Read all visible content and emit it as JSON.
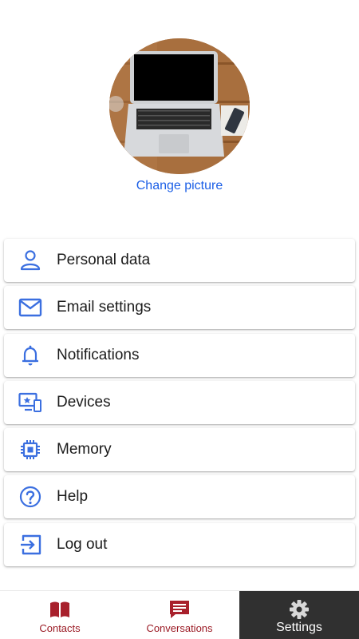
{
  "profile": {
    "change_picture_label": "Change picture"
  },
  "menu": {
    "items": [
      {
        "label": "Personal data",
        "icon": "person-icon"
      },
      {
        "label": "Email settings",
        "icon": "mail-icon"
      },
      {
        "label": "Notifications",
        "icon": "bell-icon"
      },
      {
        "label": "Devices",
        "icon": "devices-icon"
      },
      {
        "label": "Memory",
        "icon": "chip-icon"
      },
      {
        "label": "Help",
        "icon": "help-icon"
      },
      {
        "label": "Log out",
        "icon": "logout-icon"
      }
    ]
  },
  "bottom_nav": {
    "tabs": [
      {
        "label": "Contacts",
        "icon": "book-icon"
      },
      {
        "label": "Conversations",
        "icon": "chat-icon"
      },
      {
        "label": "Settings",
        "icon": "gear-icon",
        "active": true
      }
    ]
  },
  "colors": {
    "accent_blue": "#1a5ee6",
    "icon_blue": "#3b6fe0",
    "nav_red": "#9b1b25",
    "active_tab_bg": "#303030"
  }
}
